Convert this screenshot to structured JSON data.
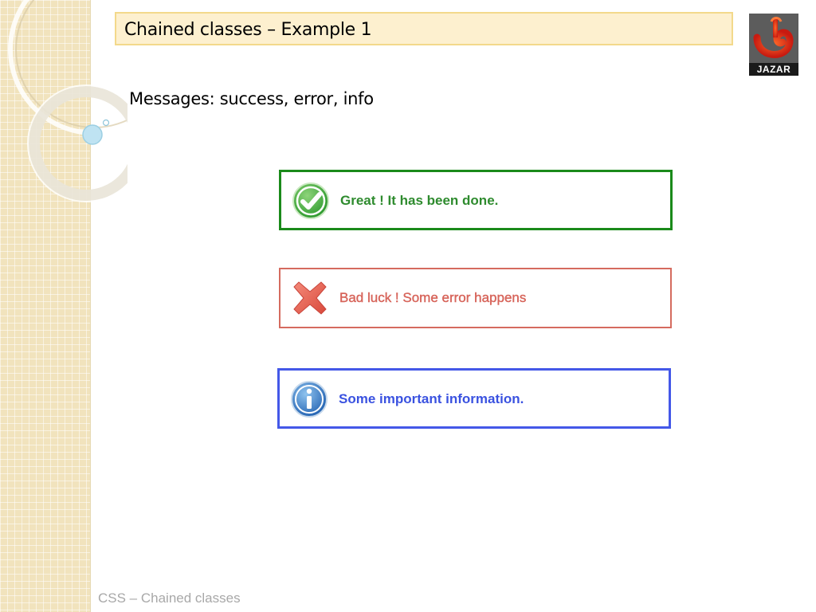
{
  "slide": {
    "title": "Chained classes – Example 1",
    "subtitle": "Messages: success, error, info",
    "footer": "CSS – Chained classes"
  },
  "logo": {
    "text": "JAZAR",
    "icon": "jazar-logo-icon"
  },
  "messages": [
    {
      "type": "success",
      "icon": "checkmark-icon",
      "text": "Great ! It has been done.",
      "color": "#2e8b2e"
    },
    {
      "type": "error",
      "icon": "cross-icon",
      "text": "Bad luck ! Some error happens",
      "color": "#d7655b"
    },
    {
      "type": "info",
      "icon": "info-icon",
      "text": "Some important information.",
      "color": "#3a52e0"
    }
  ],
  "colors": {
    "title_bg": "#fdf0cf",
    "title_border": "#f3d98b",
    "success_border": "#1a8a1a",
    "error_border": "#d56b5f",
    "info_border": "#4458e8"
  }
}
